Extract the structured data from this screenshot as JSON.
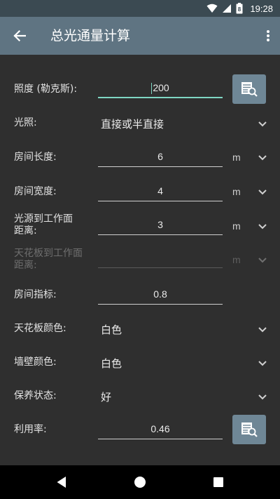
{
  "status_bar": {
    "time": "19:28",
    "battery_level": "8"
  },
  "toolbar": {
    "title": "总光通量计算"
  },
  "form": {
    "illuminance": {
      "label": "照度 (勒克斯):",
      "value": "200"
    },
    "lighting": {
      "label": "光照:",
      "value": "直接或半直接"
    },
    "room_length": {
      "label": "房间长度:",
      "value": "6",
      "unit": "m"
    },
    "room_width": {
      "label": "房间宽度:",
      "value": "4",
      "unit": "m"
    },
    "source_height": {
      "label_line1": "光源到工作面",
      "label_line2": "距离:",
      "value": "3",
      "unit": "m"
    },
    "ceiling_height": {
      "label_line1": "天花板到工作面",
      "label_line2": "距离:",
      "value": "",
      "unit": "m"
    },
    "room_index": {
      "label": "房间指标:",
      "value": "0.8"
    },
    "ceiling_color": {
      "label": "天花板颜色:",
      "value": "白色"
    },
    "wall_color": {
      "label": "墙壁颜色:",
      "value": "白色"
    },
    "maintenance": {
      "label": "保养状态:",
      "value": "好"
    },
    "utilization": {
      "label": "利用率:",
      "value": "0.46"
    }
  },
  "colors": {
    "toolbar": "#5f7482",
    "status_bar": "#3b4a52",
    "background": "#2f2f2f",
    "accent": "#7fd7c4",
    "button": "#6f8796"
  }
}
